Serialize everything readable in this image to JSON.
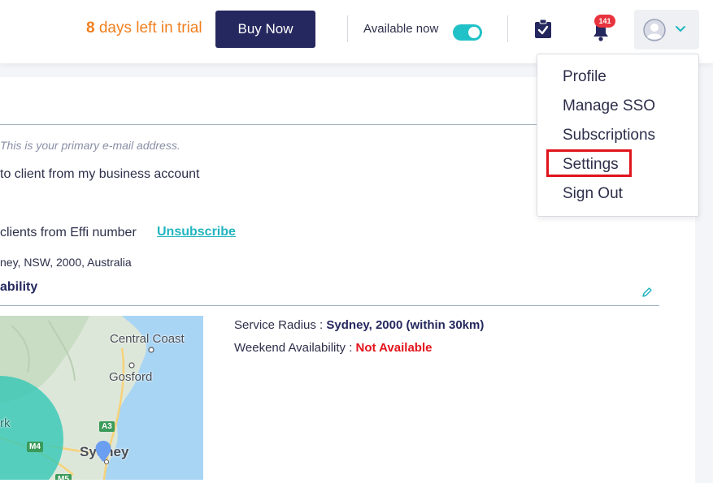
{
  "header": {
    "trial_days": "8",
    "trial_text": "days left in trial",
    "buy_label": "Buy Now",
    "available_label": "Available now",
    "available_on": true,
    "notification_count": "141"
  },
  "profile_menu": {
    "items": [
      "Profile",
      "Manage SSO",
      "Subscriptions",
      "Settings",
      "Sign Out"
    ],
    "highlighted": "Settings"
  },
  "account": {
    "email_note": "This is your primary e-mail address.",
    "business_text": "to client from my business account",
    "sms_text": "clients from Effi number",
    "unsubscribe_label": "Unsubscribe",
    "address": "ney, NSW, 2000, Australia"
  },
  "availability": {
    "title": "ability",
    "service_radius_label": "Service Radius :",
    "service_radius_value": "Sydney, 2000 (within 30km)",
    "weekend_label": "Weekend Availability :",
    "weekend_value": "Not Available"
  },
  "map": {
    "labels": {
      "central_coast": "Central Coast",
      "gosford": "Gosford",
      "sydney": "Sydney",
      "park": "rk",
      "a3": "A3",
      "m4": "M4",
      "m5": "M5"
    }
  },
  "colors": {
    "accent": "#21c1c8",
    "brand": "#25285e",
    "trial": "#f07f1e",
    "danger": "#e3141c"
  }
}
